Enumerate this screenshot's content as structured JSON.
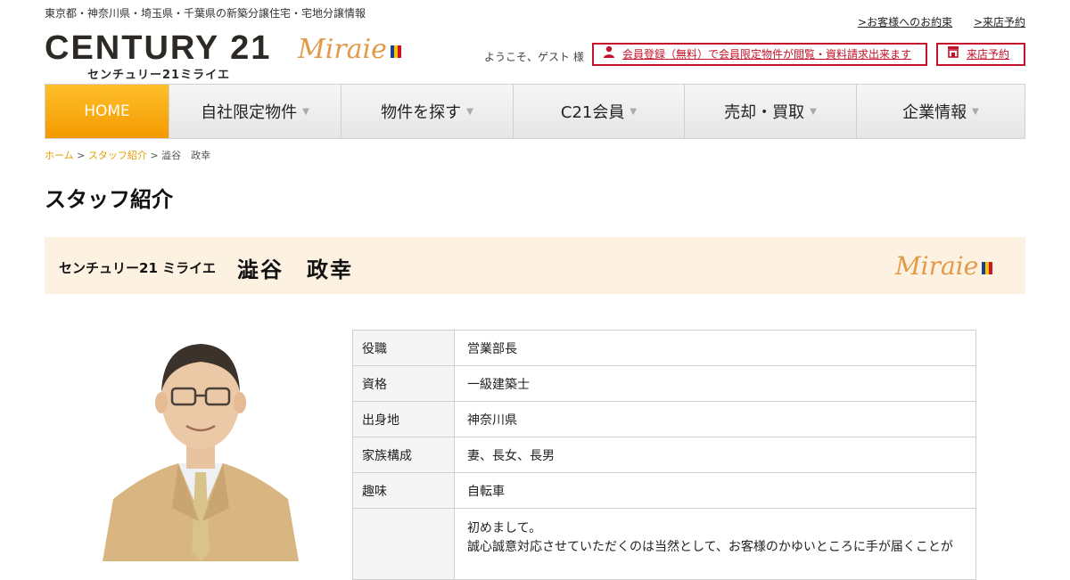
{
  "header": {
    "tagline": "東京都・神奈川県・埼玉県・千葉県の新築分譲住宅・宅地分譲情報",
    "top_links": [
      ">お客様へのお約束",
      ">来店予約"
    ],
    "logo_main": "CENTURY 21",
    "logo_sub": "センチュリー21ミライエ",
    "brand": "Miraie",
    "welcome": "ようこそ、ゲスト 様",
    "register_label": "会員登録（無料）で会員限定物件が閲覧・資料請求出来ます",
    "visit_label": "来店予約",
    "colors": {
      "accent_red": "#c3132a",
      "accent_orange": "#f39a00",
      "brand_orange": "#e39a48"
    },
    "flag_colors": [
      "#1d3f94",
      "#f7c600",
      "#d0142c"
    ]
  },
  "nav": {
    "items": [
      "HOME",
      "自社限定物件",
      "物件を探す",
      "C21会員",
      "売却・買取",
      "企業情報"
    ]
  },
  "breadcrumb": {
    "home": "ホーム",
    "staff": "スタッフ紹介",
    "sep": " > ",
    "current": "澁谷　政幸"
  },
  "page": {
    "title": "スタッフ紹介",
    "office": "センチュリー21 ミライエ",
    "staff_name": "澁谷　政幸",
    "brand": "Miraie"
  },
  "profile": {
    "rows": [
      {
        "label": "役職",
        "value": "営業部長"
      },
      {
        "label": "資格",
        "value": "一級建築士"
      },
      {
        "label": "出身地",
        "value": "神奈川県"
      },
      {
        "label": "家族構成",
        "value": "妻、長女、長男"
      },
      {
        "label": "趣味",
        "value": "自転車"
      }
    ],
    "message_label": "",
    "message_lines": [
      "初めまして。",
      "誠心誠意対応させていただくのは当然として、お客様のかゆいところに手が届くことが"
    ]
  }
}
